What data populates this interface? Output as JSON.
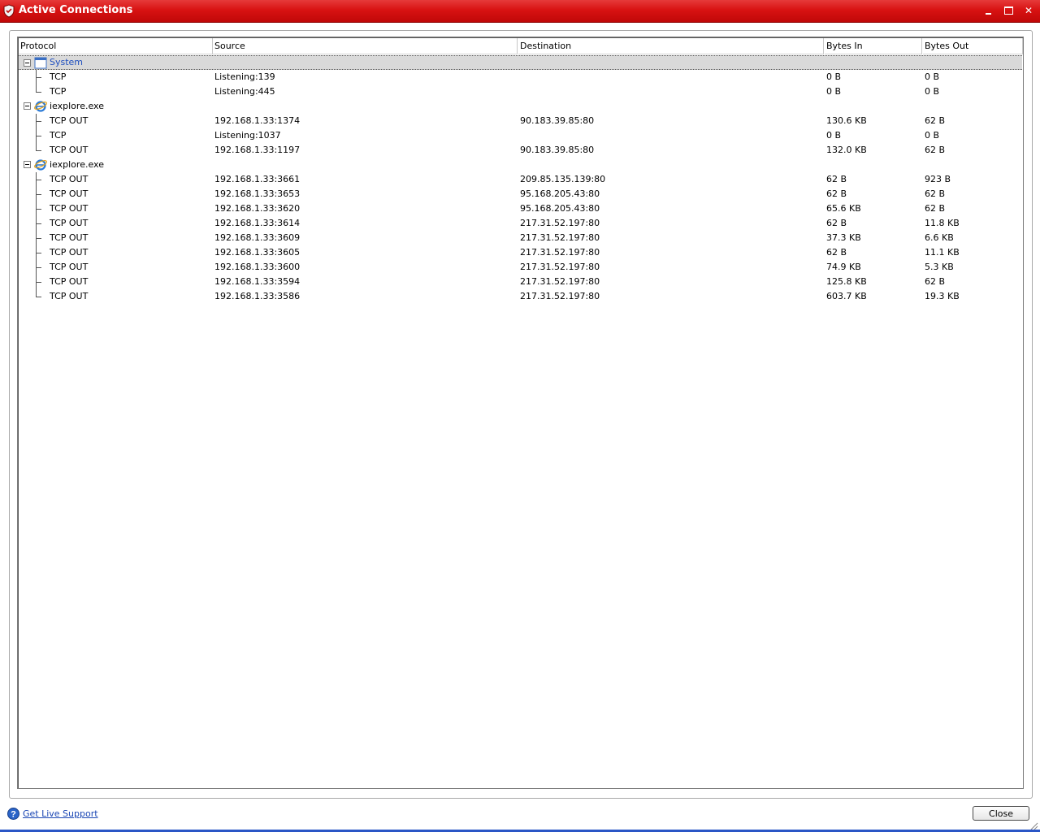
{
  "window": {
    "title": "Active Connections",
    "accent_color": "#d81212",
    "controls": [
      "minimize-icon",
      "maximize-icon",
      "close-icon"
    ]
  },
  "table": {
    "columns": [
      "Protocol",
      "Source",
      "Destination",
      "Bytes In",
      "Bytes Out"
    ],
    "groups": [
      {
        "process": "System",
        "icon": "window-icon",
        "selected": true,
        "connections": [
          {
            "protocol": "TCP",
            "source": "Listening:139",
            "destination": "",
            "bytes_in": "0 B",
            "bytes_out": "0 B"
          },
          {
            "protocol": "TCP",
            "source": "Listening:445",
            "destination": "",
            "bytes_in": "0 B",
            "bytes_out": "0 B"
          }
        ]
      },
      {
        "process": "iexplore.exe",
        "icon": "internet-explorer-icon",
        "connections": [
          {
            "protocol": "TCP OUT",
            "source": "192.168.1.33:1374",
            "destination": "90.183.39.85:80",
            "bytes_in": "130.6 KB",
            "bytes_out": "62 B"
          },
          {
            "protocol": "TCP",
            "source": "Listening:1037",
            "destination": "",
            "bytes_in": "0 B",
            "bytes_out": "0 B"
          },
          {
            "protocol": "TCP OUT",
            "source": "192.168.1.33:1197",
            "destination": "90.183.39.85:80",
            "bytes_in": "132.0 KB",
            "bytes_out": "62 B"
          }
        ]
      },
      {
        "process": "iexplore.exe",
        "icon": "internet-explorer-icon",
        "connections": [
          {
            "protocol": "TCP OUT",
            "source": "192.168.1.33:3661",
            "destination": "209.85.135.139:80",
            "bytes_in": "62 B",
            "bytes_out": "923 B"
          },
          {
            "protocol": "TCP OUT",
            "source": "192.168.1.33:3653",
            "destination": "95.168.205.43:80",
            "bytes_in": "62 B",
            "bytes_out": "62 B"
          },
          {
            "protocol": "TCP OUT",
            "source": "192.168.1.33:3620",
            "destination": "95.168.205.43:80",
            "bytes_in": "65.6 KB",
            "bytes_out": "62 B"
          },
          {
            "protocol": "TCP OUT",
            "source": "192.168.1.33:3614",
            "destination": "217.31.52.197:80",
            "bytes_in": "62 B",
            "bytes_out": "11.8 KB"
          },
          {
            "protocol": "TCP OUT",
            "source": "192.168.1.33:3609",
            "destination": "217.31.52.197:80",
            "bytes_in": "37.3 KB",
            "bytes_out": "6.6 KB"
          },
          {
            "protocol": "TCP OUT",
            "source": "192.168.1.33:3605",
            "destination": "217.31.52.197:80",
            "bytes_in": "62 B",
            "bytes_out": "11.1 KB"
          },
          {
            "protocol": "TCP OUT",
            "source": "192.168.1.33:3600",
            "destination": "217.31.52.197:80",
            "bytes_in": "74.9 KB",
            "bytes_out": "5.3 KB"
          },
          {
            "protocol": "TCP OUT",
            "source": "192.168.1.33:3594",
            "destination": "217.31.52.197:80",
            "bytes_in": "125.8 KB",
            "bytes_out": "62 B"
          },
          {
            "protocol": "TCP OUT",
            "source": "192.168.1.33:3586",
            "destination": "217.31.52.197:80",
            "bytes_in": "603.7 KB",
            "bytes_out": "19.3 KB"
          }
        ]
      }
    ]
  },
  "footer": {
    "support_link": "Get Live Support",
    "support_icon": "help-icon",
    "close_label": "Close"
  }
}
